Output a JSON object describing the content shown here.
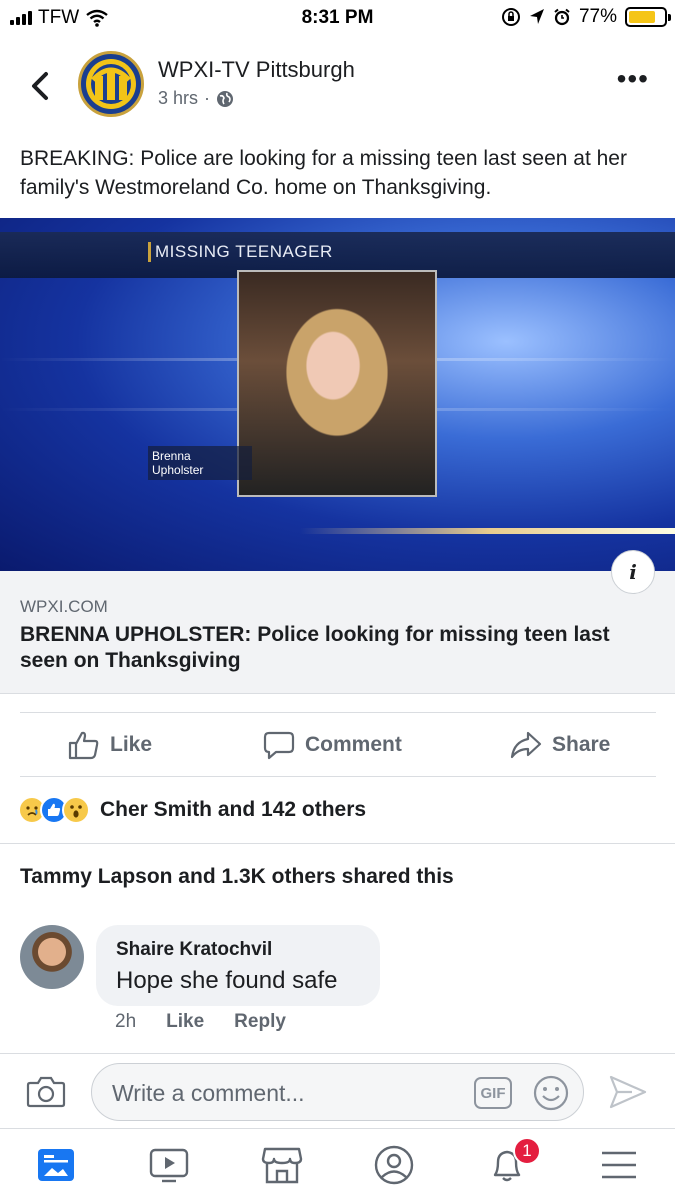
{
  "status_bar": {
    "carrier": "TFW",
    "time": "8:31 PM",
    "battery_percent": "77%",
    "battery_level": 0.77,
    "icons": [
      "signal-icon",
      "wifi-icon",
      "rotation-lock-icon",
      "location-icon",
      "alarm-icon",
      "battery-icon"
    ]
  },
  "post": {
    "page_name": "WPXI-TV Pittsburgh",
    "time_ago": "3 hrs",
    "separator": "·",
    "text": "BREAKING: Police are looking for a missing teen last seen at her family's Westmoreland Co. home on Thanksgiving."
  },
  "link": {
    "banner": "MISSING TEENAGER",
    "name_tag_line1": "Brenna",
    "name_tag_line2": "Upholster",
    "domain": "WPXI.COM",
    "headline": "BRENNA UPHOLSTER: Police looking for missing teen last seen on Thanksgiving"
  },
  "actions": {
    "like": "Like",
    "comment": "Comment",
    "share": "Share"
  },
  "reactions": {
    "icons": [
      "sad-reaction-icon",
      "like-reaction-icon",
      "wow-reaction-icon"
    ],
    "summary": "Cher Smith and 142 others"
  },
  "shares_text": "Tammy Lapson and 1.3K others shared this",
  "comment": {
    "author": "Shaire Kratochvil",
    "text": "Hope she found safe",
    "time": "2h",
    "like": "Like",
    "reply": "Reply"
  },
  "composer": {
    "placeholder": "Write a comment...",
    "gif": "GIF"
  },
  "tabbar": {
    "notifications_count": "1"
  },
  "colors": {
    "text_primary": "#1c1e21",
    "text_secondary": "#606770",
    "like_blue": "#1877f2",
    "badge_red": "#e41e3f",
    "battery_yellow": "#f5c517"
  }
}
